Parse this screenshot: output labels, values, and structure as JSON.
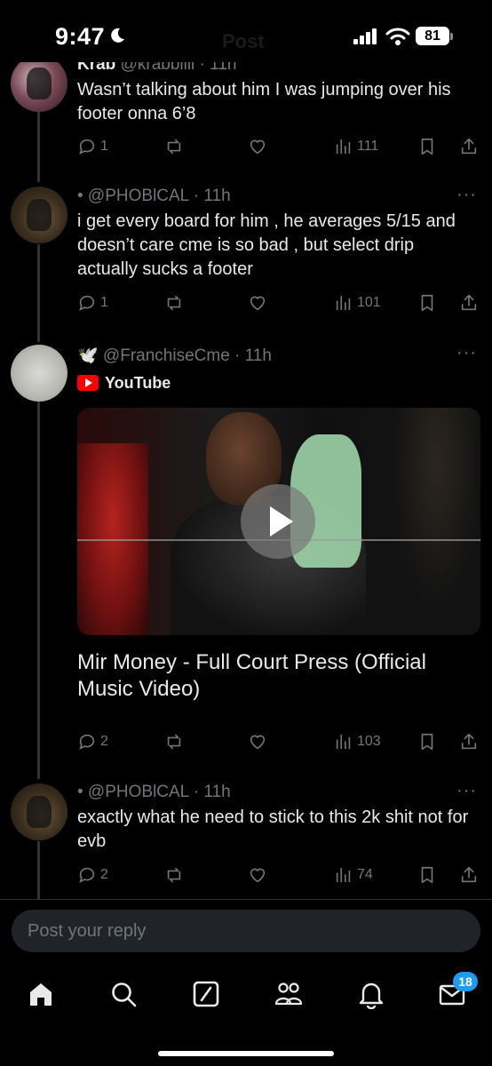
{
  "status_bar": {
    "time": "9:47",
    "battery": "81",
    "faded_title": "Post"
  },
  "posts": [
    {
      "name": "Krab",
      "handle_meta": "@krabbllll · 11h",
      "text": "Wasn’t talking about him I was jumping over his footer onna 6’8",
      "replies": "1",
      "reposts": "",
      "likes": "",
      "views": "111"
    },
    {
      "handle_meta": "• @PHOBlCAL · 11h",
      "text": "i get every board for him , he averages 5/15 and doesn’t care cme is so bad , but select drip actually sucks a footer",
      "replies": "1",
      "reposts": "",
      "likes": "",
      "views": "101"
    },
    {
      "handle_meta": "🕊️ @FranchiseCme · 11h",
      "source": "YouTube",
      "video_title": "Mir Money - Full Court Press (Official Music Video)",
      "replies": "2",
      "reposts": "",
      "likes": "",
      "views": "103"
    },
    {
      "handle_meta": "• @PHOBlCAL · 11h",
      "text": "exactly what he need to stick to this 2k shit not for evb",
      "replies": "2",
      "reposts": "",
      "likes": "",
      "views": "74"
    }
  ],
  "more_dots": "···",
  "reply": {
    "placeholder": "Post your reply"
  },
  "nav": {
    "items": [
      "home-icon",
      "search-icon",
      "grok-icon",
      "communities-icon",
      "notifications-icon",
      "messages-icon"
    ],
    "messages_badge": "18"
  },
  "colors": {
    "background": "#000000",
    "text": "#e7e9ea",
    "muted": "#71767b",
    "accent": "#1d9bf0"
  }
}
